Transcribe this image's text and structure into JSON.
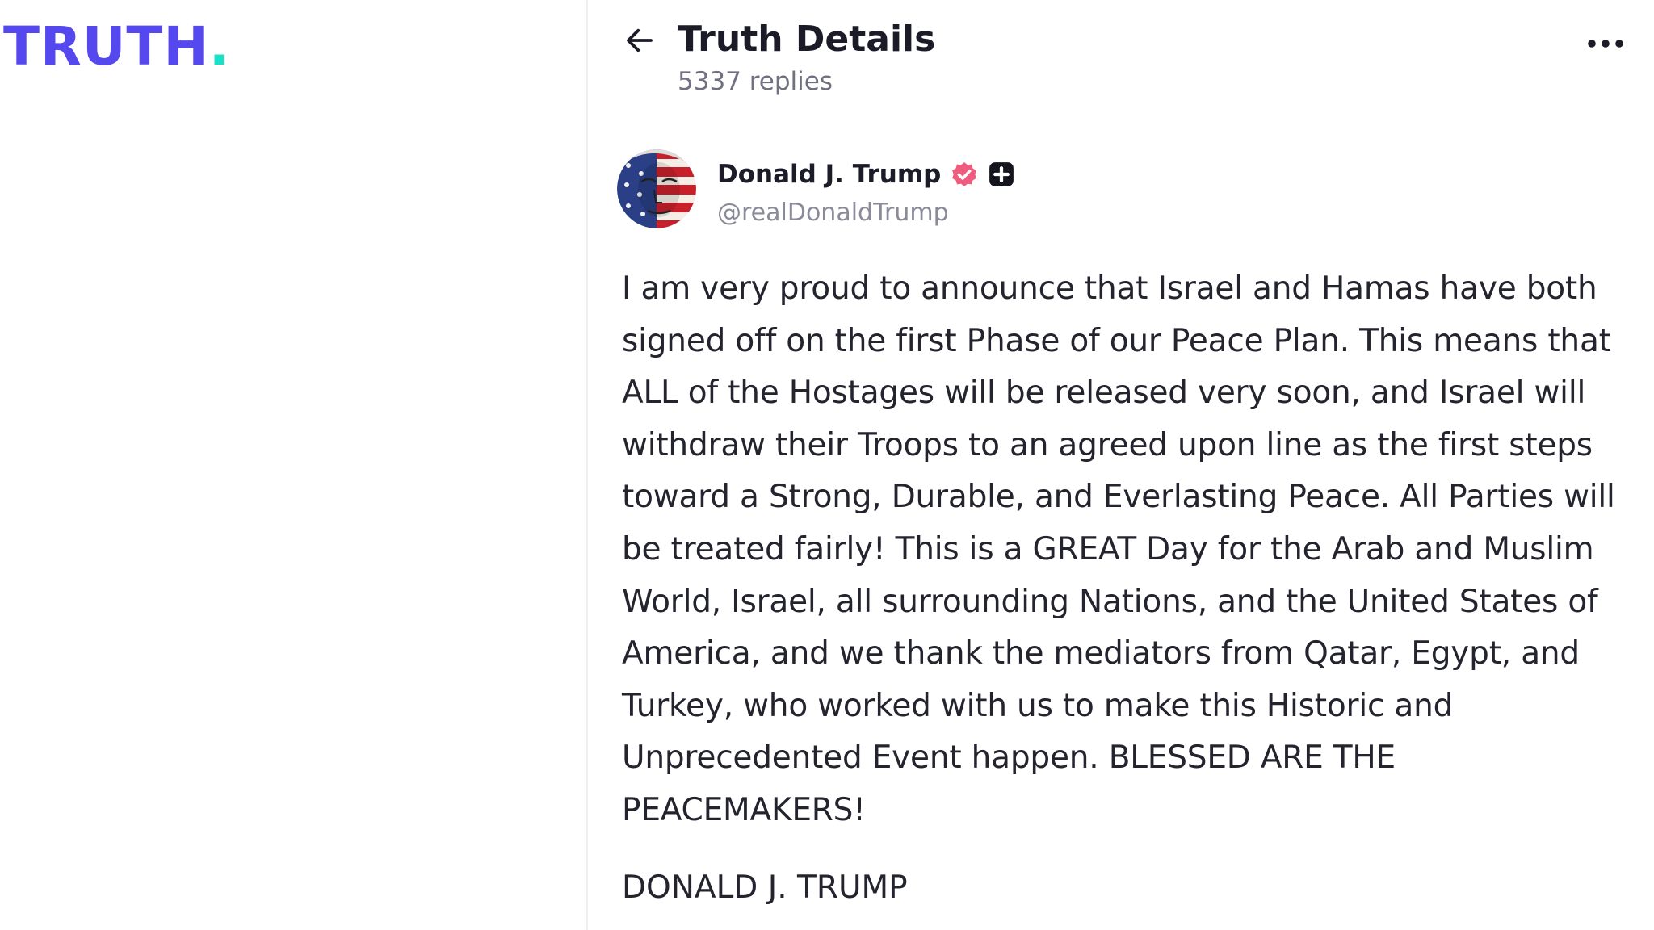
{
  "logo": {
    "text": "TRUTH",
    "dot": "."
  },
  "header": {
    "back_icon": "arrow-left-icon",
    "title": "Truth Details",
    "replies": "5337 replies",
    "more_icon": "ellipsis-icon"
  },
  "author": {
    "avatar_icon": "avatar-image",
    "name": "Donald J. Trump",
    "verified_icon": "verified-badge-icon",
    "plus_icon": "plus-badge-icon",
    "handle": "@realDonaldTrump"
  },
  "post": {
    "text": "I am very proud to announce that Israel and Hamas have both signed off on the first Phase of our Peace Plan. This means that ALL of the Hostages will be released very soon, and Israel will withdraw their Troops to an agreed upon line as the first steps toward a Strong, Durable, and Everlasting Peace. All Parties will be treated fairly! This is a GREAT Day for the Arab and Muslim World, Israel, all surrounding Nations, and the United States of America, and we thank the mediators from Qatar, Egypt, and Turkey, who worked with us to make this Historic and Unprecedented Event happen. BLESSED ARE THE PEACEMAKERS!",
    "signature": "DONALD J. TRUMP"
  },
  "colors": {
    "brand": "#5448ee",
    "brand_accent": "#17e2c7",
    "verified": "#ee5c7e",
    "text": "#24242e",
    "muted": "#8a8a99"
  }
}
